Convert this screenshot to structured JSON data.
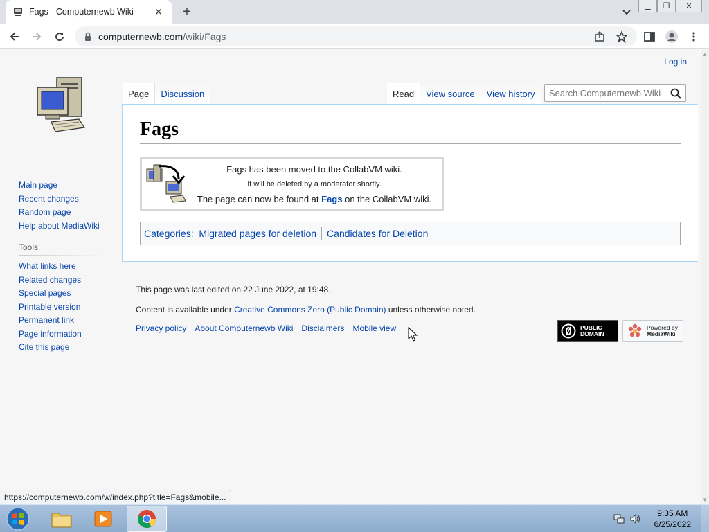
{
  "browser": {
    "tab_title": "Fags - Computernewb Wiki",
    "url_host": "computernewb.com",
    "url_path": "/wiki/Fags",
    "status_url": "https://computernewb.com/w/index.php?title=Fags&mobile..."
  },
  "wiki": {
    "personal_login": "Log in",
    "tabs_left": [
      "Page",
      "Discussion"
    ],
    "tabs_right": [
      "Read",
      "View source",
      "View history"
    ],
    "search_placeholder": "Search Computernewb Wiki",
    "nav_links": [
      "Main page",
      "Recent changes",
      "Random page",
      "Help about MediaWiki"
    ],
    "tools_title": "Tools",
    "tools_links": [
      "What links here",
      "Related changes",
      "Special pages",
      "Printable version",
      "Permanent link",
      "Page information",
      "Cite this page"
    ]
  },
  "article": {
    "title": "Fags",
    "notice_line1": "Fags has been moved to the CollabVM wiki.",
    "notice_line2": "It will be deleted by a moderator shortly.",
    "notice_line3_pre": "The page can now be found at ",
    "notice_line3_link": "Fags",
    "notice_line3_post": " on the CollabVM wiki.",
    "categories_label": "Categories",
    "categories": [
      "Migrated pages for deletion",
      "Candidates for Deletion"
    ]
  },
  "footer": {
    "last_edited": "This page was last edited on 22 June 2022, at 19:48.",
    "license_pre": "Content is available under ",
    "license_link": "Creative Commons Zero (Public Domain)",
    "license_post": " unless otherwise noted.",
    "places": [
      "Privacy policy",
      "About Computernewb Wiki",
      "Disclaimers",
      "Mobile view"
    ],
    "badge_pd": [
      "PUBLIC",
      "DOMAIN"
    ],
    "badge_mw": [
      "Powered by",
      "MediaWiki"
    ]
  },
  "taskbar": {
    "time": "9:35 AM",
    "date": "6/25/2022"
  }
}
